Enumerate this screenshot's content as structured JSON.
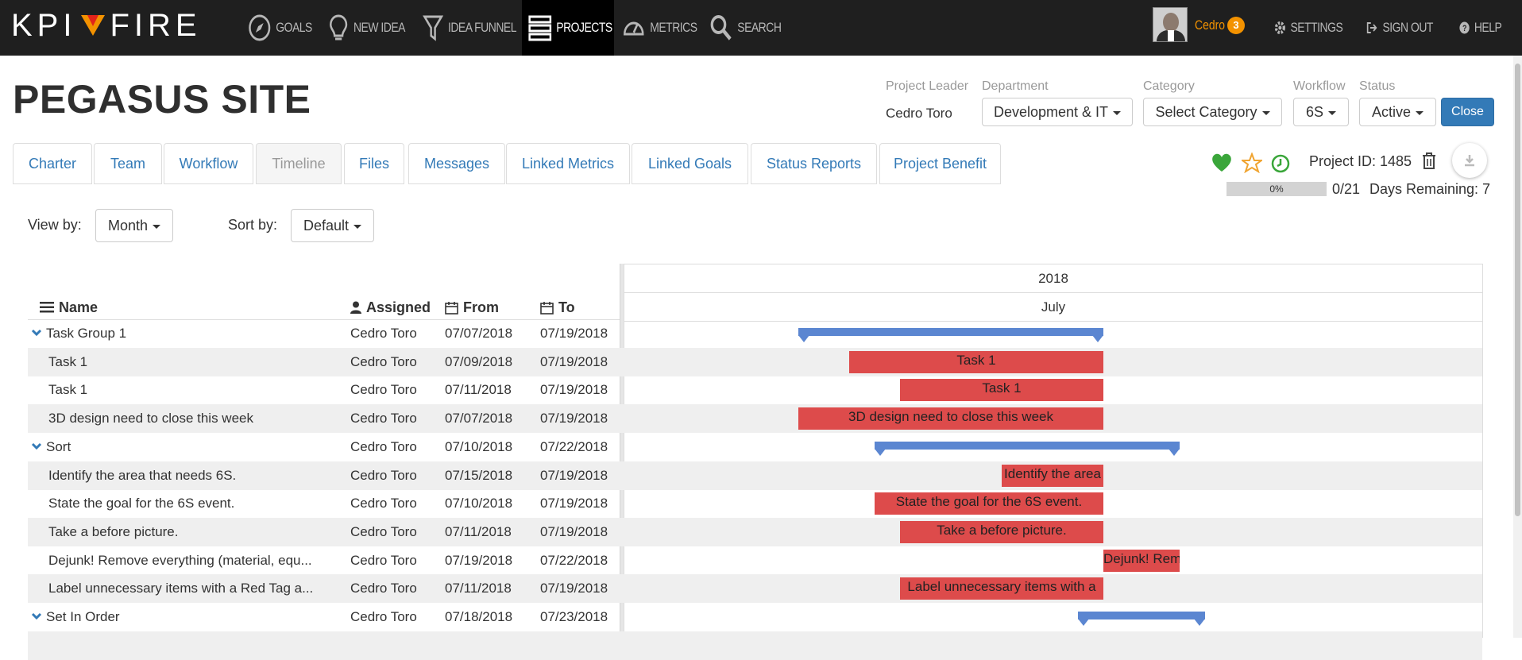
{
  "brand": {
    "logo_left": "KPI",
    "logo_right": "FIRE"
  },
  "nav": {
    "goals": "GOALS",
    "new_idea": "NEW IDEA",
    "idea_funnel": "IDEA FUNNEL",
    "projects": "PROJECTS",
    "metrics": "METRICS",
    "search": "SEARCH",
    "user_name": "Cedro",
    "notification_count": "3",
    "settings": "SETTINGS",
    "sign_out": "SIGN OUT",
    "help": "HELP"
  },
  "project": {
    "title": "PEGASUS SITE",
    "leader_label": "Project Leader",
    "leader": "Cedro Toro",
    "department_label": "Department",
    "department": "Development & IT",
    "category_label": "Category",
    "category": "Select Category",
    "workflow_label": "Workflow",
    "workflow": "6S",
    "status_label": "Status",
    "status": "Active",
    "close_label": "Close",
    "project_id": "Project ID: 1485",
    "progress_text": "0%",
    "progress_fraction": 0,
    "task_count": "0/21",
    "days_remaining": "Days Remaining: 7"
  },
  "tabs": [
    {
      "label": "Charter"
    },
    {
      "label": "Team"
    },
    {
      "label": "Workflow"
    },
    {
      "label": "Timeline",
      "active": true
    },
    {
      "label": "Files"
    },
    {
      "label": "Messages"
    },
    {
      "label": "Linked Metrics"
    },
    {
      "label": "Linked Goals"
    },
    {
      "label": "Status Reports"
    },
    {
      "label": "Project Benefit"
    }
  ],
  "controls": {
    "view_by_label": "View by:",
    "view_by": "Month",
    "sort_by_label": "Sort by:",
    "sort_by": "Default"
  },
  "columns": {
    "name": "Name",
    "assigned": "Assigned",
    "from": "From",
    "to": "To"
  },
  "timeline": {
    "year": "2018",
    "month": "July",
    "rows": [
      {
        "name": "Task Group 1",
        "group": true,
        "assigned": "Cedro Toro",
        "from": "07/07/2018",
        "to": "07/19/2018",
        "bar_label": ""
      },
      {
        "name": "Task 1",
        "assigned": "Cedro Toro",
        "from": "07/09/2018",
        "to": "07/19/2018",
        "bar_label": "Task 1"
      },
      {
        "name": "Task 1",
        "assigned": "Cedro Toro",
        "from": "07/11/2018",
        "to": "07/19/2018",
        "bar_label": "Task 1"
      },
      {
        "name": "3D design need to close this week",
        "assigned": "Cedro Toro",
        "from": "07/07/2018",
        "to": "07/19/2018",
        "bar_label": "3D design need to close this week"
      },
      {
        "name": "Sort",
        "group": true,
        "assigned": "Cedro Toro",
        "from": "07/10/2018",
        "to": "07/22/2018",
        "bar_label": ""
      },
      {
        "name": "Identify the area that needs 6S.",
        "assigned": "Cedro Toro",
        "from": "07/15/2018",
        "to": "07/19/2018",
        "bar_label": "Identify the area"
      },
      {
        "name": "State the goal for the 6S event.",
        "assigned": "Cedro Toro",
        "from": "07/10/2018",
        "to": "07/19/2018",
        "bar_label": "State the goal for the 6S event."
      },
      {
        "name": "Take a before picture.",
        "assigned": "Cedro Toro",
        "from": "07/11/2018",
        "to": "07/19/2018",
        "bar_label": "Take a before picture."
      },
      {
        "name": "Dejunk! Remove everything (material, equ...",
        "assigned": "Cedro Toro",
        "from": "07/19/2018",
        "to": "07/22/2018",
        "bar_label": "Dejunk! Remov"
      },
      {
        "name": "Label unnecessary items with a Red Tag a...",
        "assigned": "Cedro Toro",
        "from": "07/11/2018",
        "to": "07/19/2018",
        "bar_label": "Label unnecessary items with a"
      },
      {
        "name": "Set In Order",
        "group": true,
        "assigned": "Cedro Toro",
        "from": "07/18/2018",
        "to": "07/23/2018",
        "bar_label": ""
      },
      {
        "name": "",
        "assigned": "",
        "from": "",
        "to": "",
        "bar_label": ""
      }
    ]
  },
  "colors": {
    "topbar": "#1f1f1f",
    "brand_orange": "#f39200",
    "link_blue": "#337ab7",
    "task_bar": "#dd4b4b",
    "group_bar": "#5b86d1",
    "favorite_green": "#3aa63a",
    "star_orange": "#f0a430"
  }
}
